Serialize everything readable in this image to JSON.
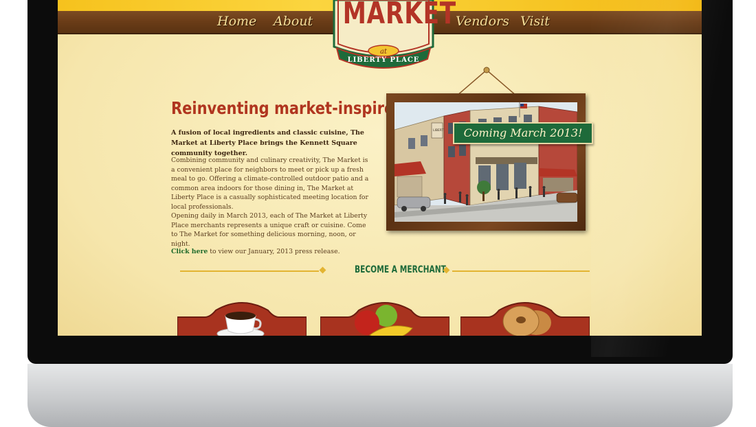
{
  "nav": {
    "home": "Home",
    "about": "About",
    "vendors": "Vendors",
    "visit": "Visit"
  },
  "logo": {
    "word": "MARKET",
    "at": "at",
    "sub": "LIBERTY PLACE"
  },
  "intro": {
    "headline": "Reinventing market-inspired traditions",
    "lede": "A fusion of local ingredients and classic cuisine, The Market at Liberty Place brings the Kennett Square community together.",
    "paragraph1": "Combining community and culinary creativity, The Market is a convenient place for neighbors to meet or pick up a fresh meal to go. Offering a climate-controlled outdoor patio and a common area indoors for those dining in, The Market at Liberty Place is a casually sophisticated meeting location for local professionals.",
    "paragraph2": "Opening daily in March 2013, each of The Market at Liberty Place merchants represents a unique craft or cuisine. Come to The Market for something delicious morning, noon, or night.",
    "press_link": "Click here",
    "press_text": " to view our January, 2013 press release."
  },
  "feature": {
    "banner": "Coming March 2013!",
    "sign_text": "LIBERTY PLACE"
  },
  "merchant_section": {
    "heading": "BECOME A MERCHANT",
    "cards": [
      {
        "icon": "coffee-cup-icon"
      },
      {
        "icon": "fruit-icon"
      },
      {
        "icon": "bagel-icon"
      }
    ]
  },
  "colors": {
    "brand_red": "#b0351f",
    "brand_green": "#1e6a3a",
    "wood": "#6a3c17",
    "gold": "#e3b432",
    "paper": "#f6e6ac"
  }
}
